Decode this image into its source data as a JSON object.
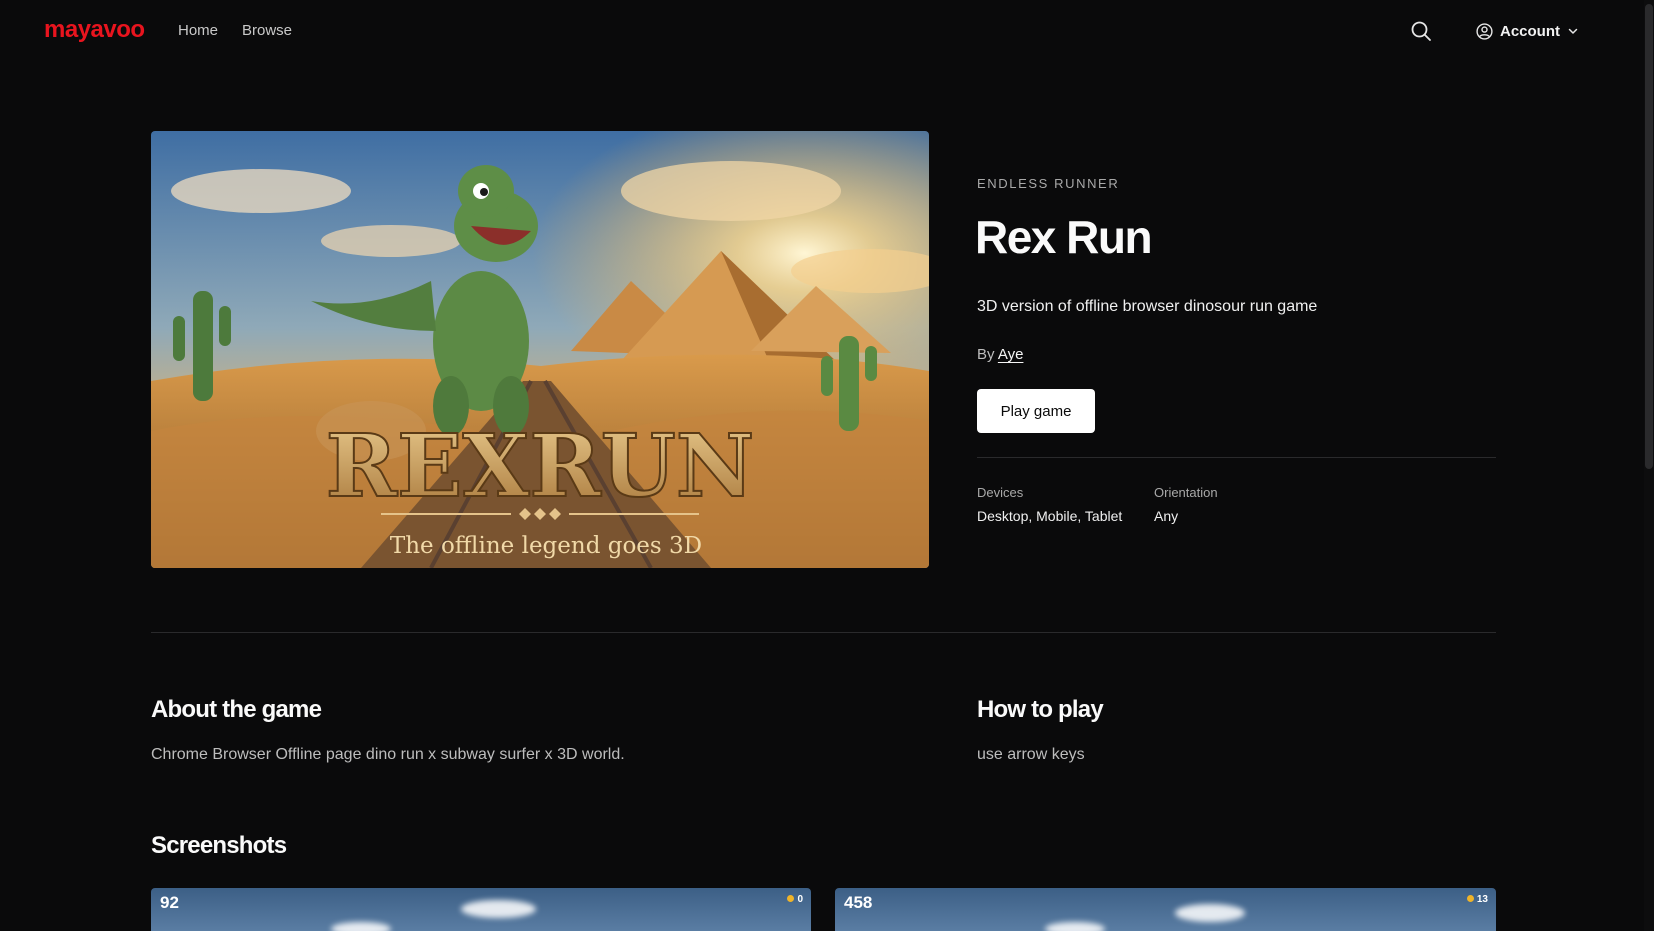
{
  "brand": {
    "logo_text": "mayavoo",
    "logo_color": "#e8141e"
  },
  "nav": {
    "links": [
      "Home",
      "Browse"
    ],
    "search_icon": "search-icon",
    "account_label": "Account",
    "account_icon": "user-circle-icon",
    "account_chevron": "chevron-down-icon"
  },
  "hero": {
    "image_title_text": "REXRUN",
    "image_tagline_text": "The offline legend goes 3D"
  },
  "game": {
    "genre": "ENDLESS RUNNER",
    "title": "Rex Run",
    "tagline": "3D version of offline browser dinosour run game",
    "by_prefix": "By",
    "author": "Aye",
    "play_label": "Play game",
    "meta": {
      "devices_label": "Devices",
      "devices_value": "Desktop, Mobile, Tablet",
      "orientation_label": "Orientation",
      "orientation_value": "Any"
    }
  },
  "about": {
    "title": "About the game",
    "text": "Chrome Browser Offline page dino run x subway surfer x 3D world."
  },
  "howto": {
    "title": "How to play",
    "text": "use arrow keys"
  },
  "screenshots": {
    "title": "Screenshots",
    "items": [
      {
        "score": "92",
        "coins": "0"
      },
      {
        "score": "458",
        "coins": "13"
      }
    ]
  }
}
